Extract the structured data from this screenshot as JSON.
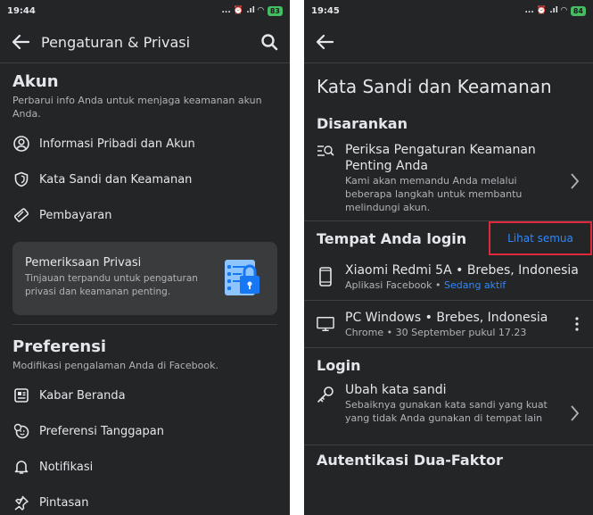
{
  "left": {
    "status": {
      "time": "19:44",
      "icons": "... ⏰ .ıl ◠",
      "battery": "83"
    },
    "header": {
      "title": "Pengaturan & Privasi",
      "search_icon": "search-icon",
      "back_icon": "back-arrow-icon"
    },
    "akun": {
      "title": "Akun",
      "subtitle": "Perbarui info Anda untuk menjaga keamanan akun Anda.",
      "items": [
        {
          "label": "Informasi Pribadi dan Akun",
          "icon": "user-circle-icon"
        },
        {
          "label": "Kata Sandi dan Keamanan",
          "icon": "shield-icon"
        },
        {
          "label": "Pembayaran",
          "icon": "tag-icon"
        }
      ]
    },
    "privacy_card": {
      "title": "Pemeriksaan Privasi",
      "text": "Tinjauan terpandu untuk pengaturan privasi dan keamanan penting.",
      "icon": "privacy-checkup-icon"
    },
    "preferensi": {
      "title": "Preferensi",
      "subtitle": "Modifikasi pengalaman Anda di Facebook.",
      "items": [
        {
          "label": "Kabar Beranda",
          "icon": "news-feed-icon"
        },
        {
          "label": "Preferensi Tanggapan",
          "icon": "reactions-icon"
        },
        {
          "label": "Notifikasi",
          "icon": "bell-icon"
        },
        {
          "label": "Pintasan",
          "icon": "pin-icon"
        }
      ]
    }
  },
  "right": {
    "status": {
      "time": "19:45",
      "icons": "... ⏰ .ıl ◠",
      "battery": "84"
    },
    "title": "Kata Sandi dan Keamanan",
    "disarankan": {
      "title": "Disarankan",
      "item_title": "Periksa Pengaturan Keamanan Penting Anda",
      "item_text": "Kami akan memandu Anda melalui beberapa langkah untuk membantu melindungi akun."
    },
    "login_places": {
      "title": "Tempat Anda login",
      "see_all": "Lihat semua",
      "devices": [
        {
          "name": "Xiaomi Redmi 5A • Brebes, Indonesia",
          "detail": "Aplikasi Facebook • ",
          "status": "Sedang aktif",
          "icon": "phone-icon"
        },
        {
          "name": "PC Windows • Brebes, Indonesia",
          "detail": "Chrome • 30 September pukul 17.23",
          "status": "",
          "icon": "monitor-icon"
        }
      ]
    },
    "login": {
      "title": "Login",
      "item_title": "Ubah kata sandi",
      "item_text": "Sebaiknya gunakan kata sandi yang kuat yang tidak Anda gunakan di tempat lain"
    },
    "two_factor": {
      "title": "Autentikasi Dua-Faktor"
    }
  }
}
